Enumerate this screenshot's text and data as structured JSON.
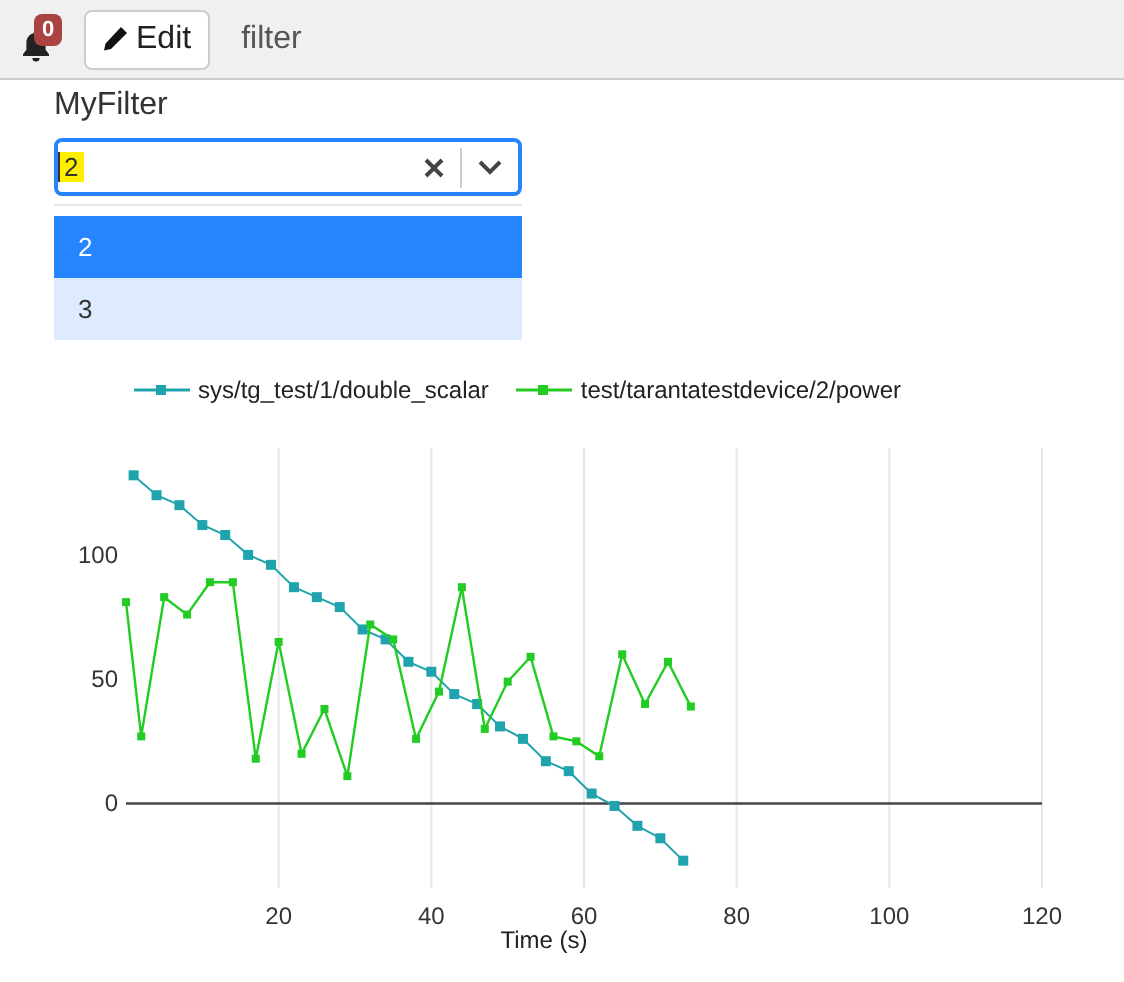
{
  "toolbar": {
    "notifications": {
      "count": "0"
    },
    "edit_button": {
      "label": "Edit"
    },
    "title": "filter"
  },
  "filter": {
    "label": "MyFilter",
    "value": "2",
    "highlighted": true,
    "options": [
      {
        "label": "2",
        "selected": true,
        "focused": false
      },
      {
        "label": "3",
        "selected": false,
        "focused": true
      }
    ]
  },
  "chart_data": {
    "type": "line",
    "xlabel": "Time (s)",
    "grid": true,
    "xlim": [
      0,
      120
    ],
    "ylim": [
      -34,
      143
    ],
    "xticks": [
      20,
      40,
      60,
      80,
      100,
      120
    ],
    "yticks": [
      0,
      50,
      100
    ],
    "series": [
      {
        "name": "sys/tg_test/1/double_scalar",
        "color": "#1fa3ad",
        "marker": "square",
        "x": [
          1,
          4,
          7,
          10,
          13,
          16,
          19,
          22,
          25,
          28,
          31,
          34,
          37,
          40,
          43,
          46,
          49,
          52,
          55,
          58,
          61,
          64,
          67,
          70,
          73
        ],
        "values": [
          132,
          124,
          120,
          112,
          108,
          100,
          96,
          87,
          83,
          79,
          70,
          66,
          57,
          53,
          44,
          40,
          31,
          26,
          17,
          13,
          4,
          -1,
          -9,
          -14,
          -23
        ]
      },
      {
        "name": "test/tarantatestdevice/2/power",
        "color": "#22cc22",
        "marker": "square",
        "x": [
          0,
          2,
          5,
          8,
          11,
          14,
          17,
          20,
          23,
          26,
          29,
          32,
          35,
          38,
          41,
          44,
          47,
          50,
          53,
          56,
          59,
          62,
          65,
          68,
          71,
          74
        ],
        "values": [
          81,
          27,
          83,
          76,
          89,
          89,
          18,
          65,
          20,
          38,
          11,
          72,
          66,
          26,
          45,
          87,
          30,
          49,
          59,
          27,
          25,
          19,
          60,
          40,
          57,
          39
        ]
      }
    ]
  }
}
